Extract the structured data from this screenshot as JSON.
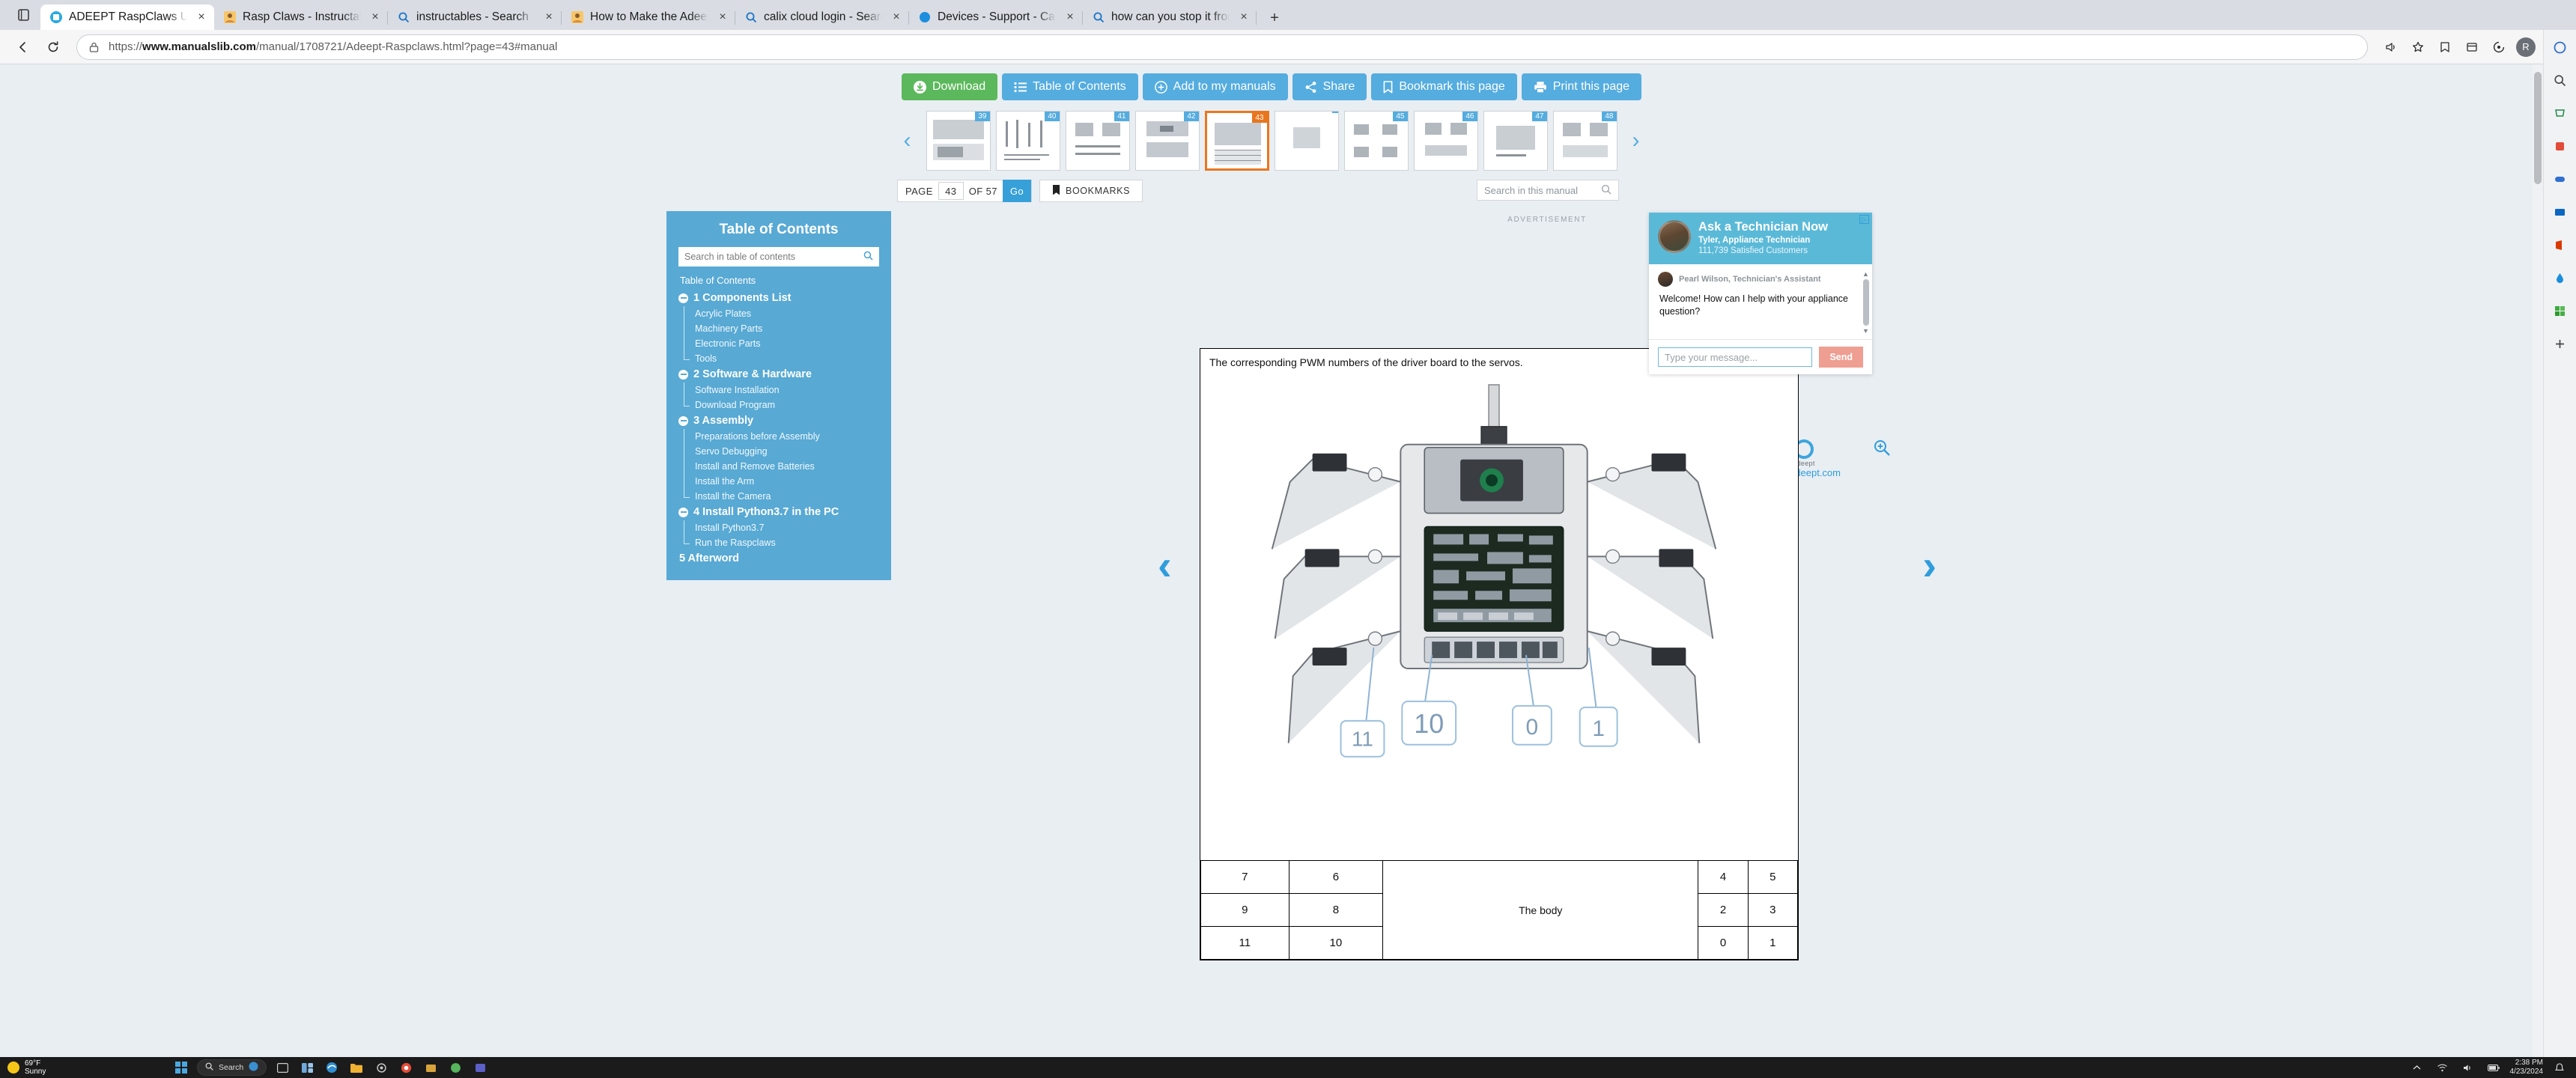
{
  "browser": {
    "tabs": [
      {
        "title": "ADEEPT RaspClaws User Manual",
        "favicon": "manualslib-icon",
        "active": true
      },
      {
        "title": "Rasp Claws - Instructables",
        "favicon": "instructables-icon",
        "active": false
      },
      {
        "title": "instructables - Search",
        "favicon": "bing-search-icon",
        "active": false
      },
      {
        "title": "How to Make the Adeept Raspcla",
        "favicon": "instructables-icon",
        "active": false
      },
      {
        "title": "calix cloud login - Search",
        "favicon": "bing-search-icon",
        "active": false
      },
      {
        "title": "Devices - Support - Calix Cloud",
        "favicon": "calix-icon",
        "active": false
      },
      {
        "title": "how can you stop it from closing",
        "favicon": "bing-search-icon",
        "active": false
      }
    ],
    "tab_close_label": "×",
    "newtab_label": "+",
    "nav": {
      "back_icon": "back-arrow-icon",
      "forward_icon": "forward-arrow-icon",
      "reload_icon": "reload-icon",
      "lock_icon": "lock-icon",
      "url_domain": "www.manualslib.com",
      "url_prefix": "https://",
      "url_path": "/manual/1708721/Adeept-Raspclaws.html?page=43#manual",
      "right_icons": [
        "read-aloud-icon",
        "add-to-favorites-icon",
        "favorites-icon",
        "collections-icon",
        "browser-essentials-icon",
        "profile-icon",
        "settings-more-icon"
      ],
      "avatar_initial": "R"
    },
    "sidebar_rail_icons": [
      "copilot-icon",
      "search-icon",
      "shopping-icon",
      "tools-icon",
      "games-icon",
      "outlook-icon",
      "office-icon",
      "drop-icon",
      "microsoft-store-icon",
      "add-sidebar-icon"
    ]
  },
  "manual_toolbar": {
    "download": "Download",
    "table_of_contents": "Table of Contents",
    "add_to_my_manuals": "Add to my manuals",
    "share": "Share",
    "bookmark_this_page": "Bookmark this page",
    "print_this_page": "Print this page"
  },
  "thumbnails": {
    "prev_label": "‹",
    "next_label": "›",
    "pages": [
      "39",
      "40",
      "41",
      "42",
      "43",
      "",
      "45",
      "46",
      "47",
      "48"
    ],
    "current_index": 4
  },
  "pagebar": {
    "page_label": "PAGE",
    "page_value": "43",
    "of_label": "OF 57",
    "go_label": "Go",
    "bookmarks_label": "BOOKMARKS",
    "search_placeholder": "Search in this manual"
  },
  "toc": {
    "title": "Table of Contents",
    "search_placeholder": "Search in table of contents",
    "root_label": "Table of Contents",
    "chapters": [
      {
        "label": "1 Components List",
        "expandable": true,
        "items": [
          "Acrylic Plates",
          "Machinery Parts",
          "Electronic Parts",
          "Tools"
        ]
      },
      {
        "label": "2 Software & Hardware",
        "expandable": true,
        "items": [
          "Software Installation",
          "Download Program"
        ]
      },
      {
        "label": "3 Assembly",
        "expandable": true,
        "items": [
          "Preparations before Assembly",
          "Servo Debugging",
          "Install and Remove Batteries",
          "Install the Arm",
          "Install the Camera"
        ]
      },
      {
        "label": "4 Install Python3.7 in the PC",
        "expandable": true,
        "items": [
          "Install Python3.7",
          "Run the Raspclaws"
        ]
      },
      {
        "label": "5 Afterword",
        "expandable": false,
        "items": []
      }
    ]
  },
  "document": {
    "ad_label": "ADVERTISEMENT",
    "brand_name": "Adeept",
    "brand_url": "www.adeept.com",
    "zoom_icon": "zoom-in-icon",
    "prev_page_icon": "prev-page-arrow-icon",
    "next_page_icon": "next-page-arrow-icon",
    "caption": "The corresponding PWM numbers of the driver board to the servos.",
    "callouts": [
      "11",
      "10",
      "0",
      "1"
    ],
    "table": {
      "body_label": "The body",
      "rows": [
        [
          "7",
          "6",
          "4",
          "5"
        ],
        [
          "9",
          "8",
          "2",
          "3"
        ],
        [
          "11",
          "10",
          "0",
          "1"
        ]
      ]
    }
  },
  "chat": {
    "title": "Ask a Technician Now",
    "subtitle": "Tyler, Appliance Technician",
    "customers": "111,739 Satisfied Customers",
    "ad_choices_label": "▷",
    "agent_name": "Pearl Wilson, Technician's Assistant",
    "message": "Welcome! How can I help with your appliance question?",
    "input_placeholder": "Type your message...",
    "send_label": "Send",
    "scroll_up": "▲",
    "scroll_down": "▼"
  },
  "taskbar": {
    "weather_temp": "69°F",
    "weather_desc": "Sunny",
    "start_icon": "windows-start-icon",
    "search_placeholder": "Search",
    "icons": [
      "task-view-icon",
      "widgets-icon",
      "edge-icon",
      "file-explorer-icon",
      "settings-icon",
      "chrome-icon",
      "store-icon",
      "app-icon",
      "teams-icon"
    ],
    "tray_icons": [
      "show-hidden-icons",
      "network-icon",
      "volume-icon",
      "battery-icon"
    ],
    "time": "2:38 PM",
    "date": "4/23/2024",
    "notification_icon": "notifications-icon"
  }
}
